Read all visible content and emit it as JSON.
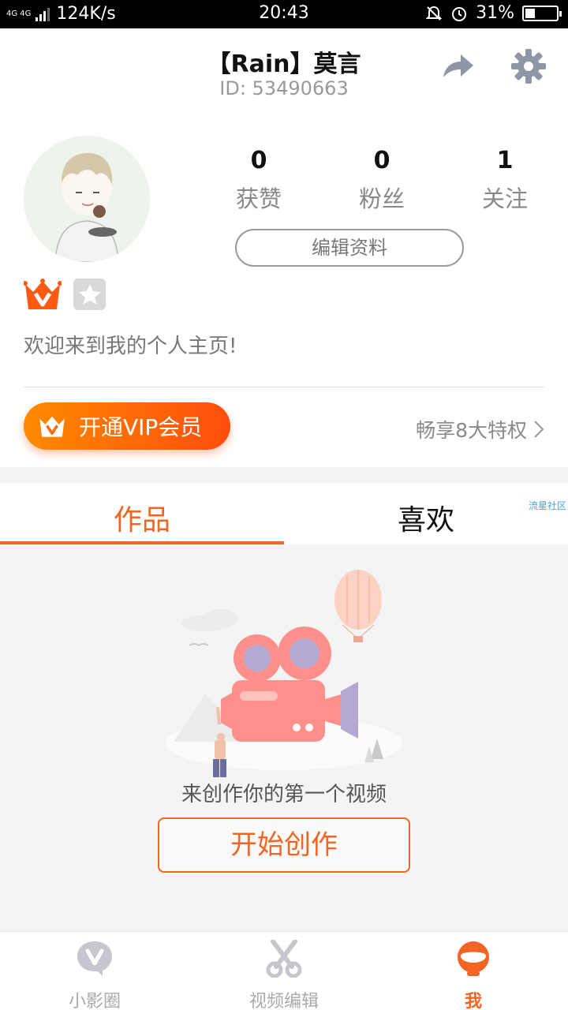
{
  "status_bar": {
    "network": "4G 4G",
    "speed": "124K/s",
    "time": "20:43",
    "battery": "31%",
    "battery_level": 0.31
  },
  "header": {
    "username": "【Rain】莫言",
    "user_id": "ID: 53490663"
  },
  "stats": [
    {
      "value": "0",
      "label": "获赞"
    },
    {
      "value": "0",
      "label": "粉丝"
    },
    {
      "value": "1",
      "label": "关注"
    }
  ],
  "profile": {
    "edit_label": "编辑资料",
    "bio": "欢迎来到我的个人主页!"
  },
  "vip": {
    "button_label": "开通VIP会员",
    "link_label": "畅享8大特权"
  },
  "tabs": {
    "works": "作品",
    "likes": "喜欢",
    "watermark": "流星社区"
  },
  "empty_state": {
    "message": "来创作你的第一个视频",
    "button_label": "开始创作"
  },
  "bottom_nav": [
    {
      "label": "小影圈",
      "icon": "chat-bubble-v-icon"
    },
    {
      "label": "视频编辑",
      "icon": "scissors-icon"
    },
    {
      "label": "我",
      "icon": "profile-face-icon"
    }
  ],
  "colors": {
    "accent": "#f26522",
    "vip_gradient_start": "#ff8a00",
    "vip_gradient_end": "#ff4d0d",
    "muted_text": "#888888"
  }
}
